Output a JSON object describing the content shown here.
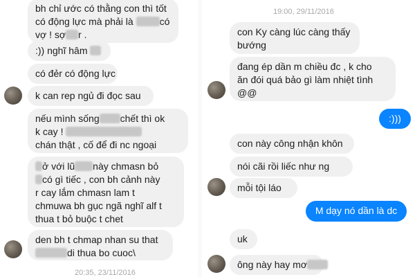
{
  "left": {
    "messages": [
      {
        "parts": [
          "bh chỉ ước có thằng con thì tốt",
          "có động lực mà phải là ",
          "BLUR",
          "có",
          "vợ ! sợ",
          "BLUR",
          "r ."
        ]
      },
      {
        "parts": [
          ":)) nghĩ hâm ",
          "BLUR"
        ]
      },
      {
        "parts": [
          "có đẻr có động lực"
        ]
      },
      {
        "parts": [
          "k can rep ngủ đi đọc sau"
        ]
      },
      {
        "parts": [
          "nếu mình sống",
          "BLUR",
          "chết thì ok",
          "k cay ! ",
          "BLUR",
          "chán thật , cố để đi nc ngoại"
        ]
      },
      {
        "parts": [
          "BLUR",
          "ở với lũ",
          "BLUR",
          "này chmasn bỏ",
          "BLUR",
          "có gì tiếc , con bh cảnh này",
          "r cay lắm chmasn lam t",
          "chmuwa bh gục ngã nghĩ alf t",
          "thua t bỏ buộc t chet"
        ]
      },
      {
        "parts": [
          "den bh t chmap nhan su that",
          "BLUR",
          "di thua bo cuoc\\"
        ]
      }
    ],
    "timestamp": "20:35, 23/11/2016"
  },
  "right": {
    "timestamp": "19:00, 29/11/2016",
    "messages": [
      {
        "lines": [
          "con Ky càng lúc càng thấy",
          "bướng"
        ]
      },
      {
        "lines": [
          "đang ép dần m chiều đc , k cho",
          "ăn đói quá bảo gì làm nhiệt tình",
          "@@"
        ]
      },
      {
        "lines": [
          ":)))"
        ]
      },
      {
        "lines": [
          "con này công nhận khôn"
        ]
      },
      {
        "lines": [
          "nói cãi rồi liếc như ng"
        ]
      },
      {
        "lines": [
          "mỗi tội láo"
        ]
      },
      {
        "lines": [
          "M dạy nó dần là dc"
        ]
      },
      {
        "lines": [
          "uk"
        ]
      },
      {
        "lines": [
          "ông này hay mơ"
        ]
      }
    ]
  },
  "colors": {
    "incoming_bubble": "#f1f0f0",
    "outgoing_bubble": "#0a84ff",
    "timestamp": "#a7a7a7"
  }
}
